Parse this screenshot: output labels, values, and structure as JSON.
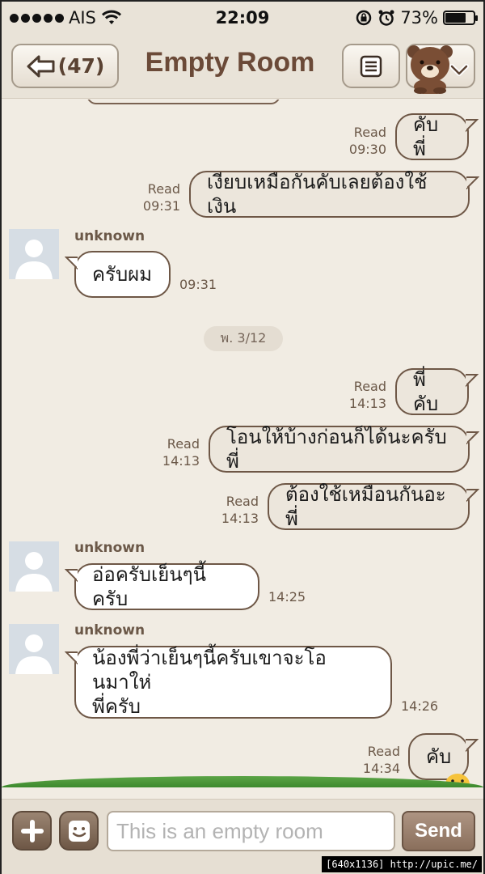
{
  "status_bar": {
    "carrier": "AIS",
    "time": "22:09",
    "battery": "73%",
    "battery_level": 0.73
  },
  "header": {
    "back_count": "(47)",
    "title": "Empty Room"
  },
  "date_separator": "พ. 3/12",
  "messages": [
    {
      "from": "me",
      "text": "คับพี่",
      "status": "Read",
      "time": "09:30"
    },
    {
      "from": "me",
      "text": "เงียบเหมือกันคับเลยต้องใช้เงิน",
      "status": "Read",
      "time": "09:31"
    },
    {
      "from": "unknown",
      "text": "ครับผม",
      "time": "09:31"
    },
    {
      "from": "me",
      "text": "พี่คับ",
      "status": "Read",
      "time": "14:13"
    },
    {
      "from": "me",
      "text": "โอนให้บ้างก่อนก็ได้นะครับพี่",
      "status": "Read",
      "time": "14:13"
    },
    {
      "from": "me",
      "text": "ต้องใช้เหมือนกันอะพี่",
      "status": "Read",
      "time": "14:13"
    },
    {
      "from": "unknown",
      "text": "อ่อครับเย็นๆนี้ครับ",
      "time": "14:25"
    },
    {
      "from": "unknown",
      "text_line1": "น้องพี่ว่าเย็นๆนี้ครับเขาจะโอนมาให่",
      "text_line2": "พี่ครับ",
      "time": "14:26"
    },
    {
      "from": "me",
      "text": "คับ",
      "status": "Read",
      "time": "14:34"
    }
  ],
  "sender_name": "unknown",
  "input": {
    "placeholder": "This is an empty room",
    "send_label": "Send"
  },
  "watermark": "[640x1136] http://upic.me/",
  "colors": {
    "header_title": "#6b4a38",
    "bubble_border": "#6e5746",
    "background": "#f1ece3"
  }
}
